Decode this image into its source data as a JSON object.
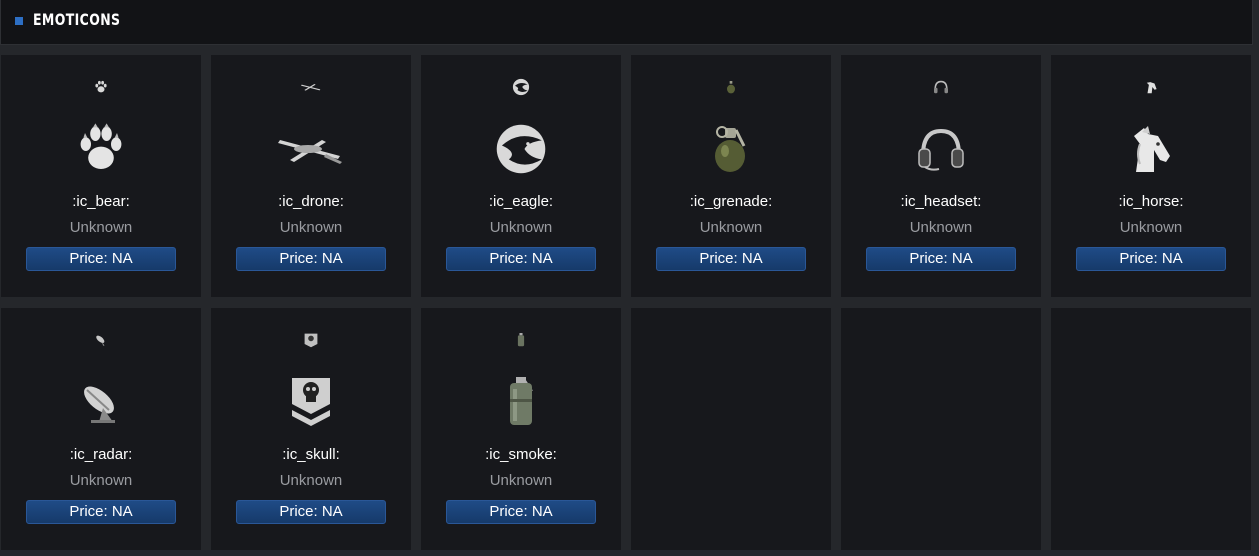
{
  "header": {
    "title": "EMOTICONS"
  },
  "emoticons": [
    {
      "name": ":ic_bear:",
      "status": "Unknown",
      "price": "Price: NA",
      "icon": "bear-paw-icon"
    },
    {
      "name": ":ic_drone:",
      "status": "Unknown",
      "price": "Price: NA",
      "icon": "drone-icon"
    },
    {
      "name": ":ic_eagle:",
      "status": "Unknown",
      "price": "Price: NA",
      "icon": "eagle-icon"
    },
    {
      "name": ":ic_grenade:",
      "status": "Unknown",
      "price": "Price: NA",
      "icon": "grenade-icon"
    },
    {
      "name": ":ic_headset:",
      "status": "Unknown",
      "price": "Price: NA",
      "icon": "headset-icon"
    },
    {
      "name": ":ic_horse:",
      "status": "Unknown",
      "price": "Price: NA",
      "icon": "horse-icon"
    },
    {
      "name": ":ic_radar:",
      "status": "Unknown",
      "price": "Price: NA",
      "icon": "radar-dish-icon"
    },
    {
      "name": ":ic_skull:",
      "status": "Unknown",
      "price": "Price: NA",
      "icon": "skull-chevron-icon"
    },
    {
      "name": ":ic_smoke:",
      "status": "Unknown",
      "price": "Price: NA",
      "icon": "smoke-grenade-icon"
    }
  ],
  "colors": {
    "background": "#25272b",
    "card": "#17181c",
    "accent": "#2d6fc4",
    "price_button": "#1f4b86",
    "status_text": "#9a9ca1"
  }
}
